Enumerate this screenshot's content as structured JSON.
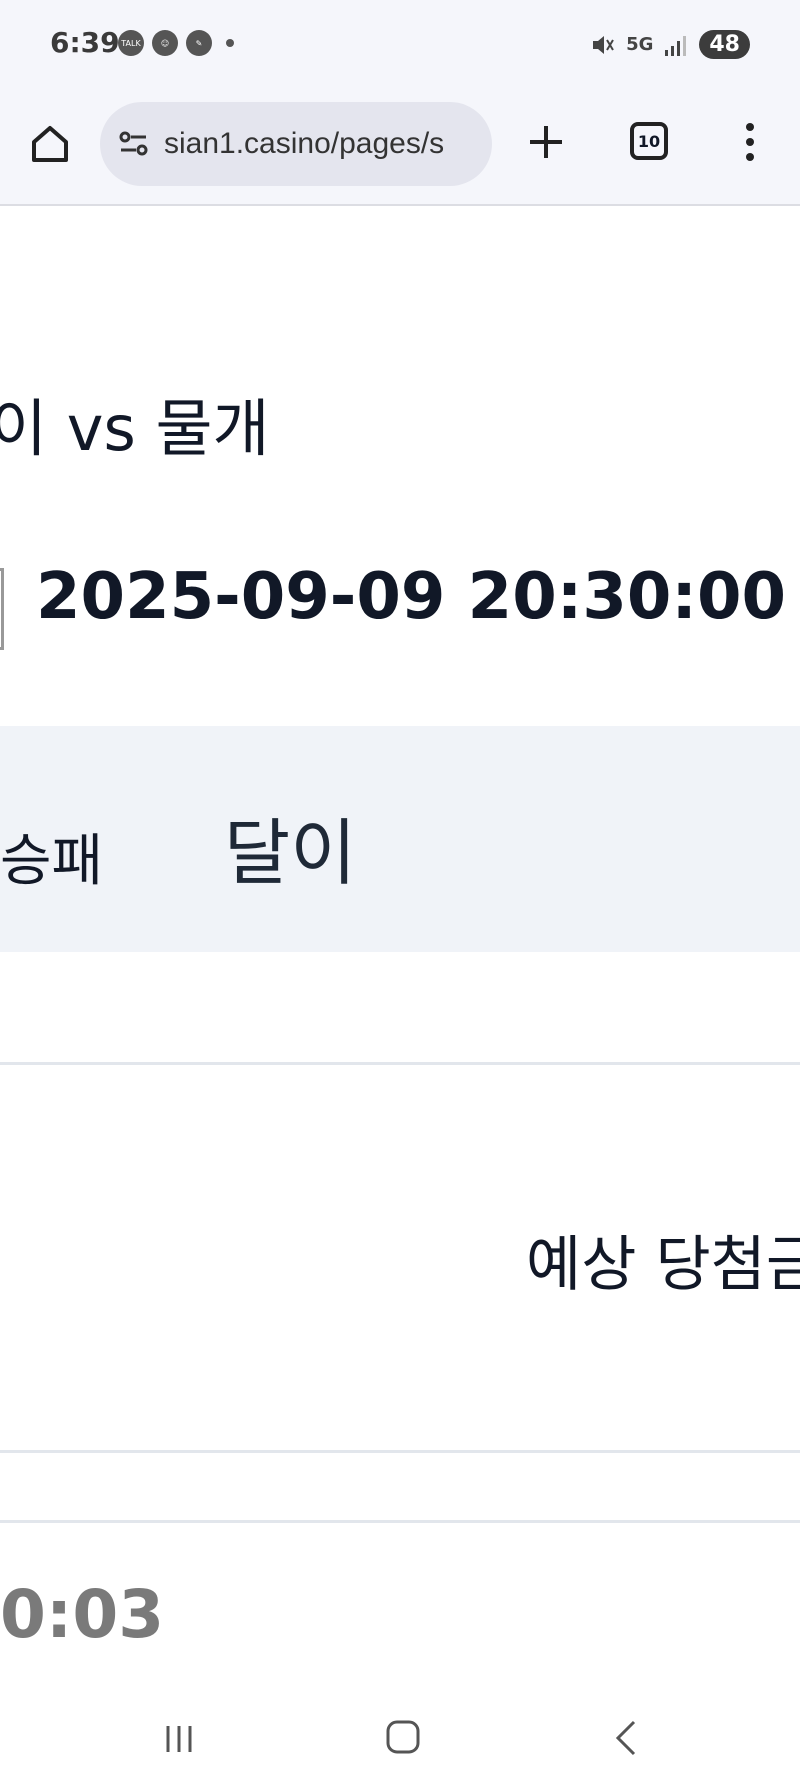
{
  "status_bar": {
    "time": "6:39",
    "left_icons": [
      "talk-icon",
      "face-icon",
      "feather-icon"
    ],
    "right_icons": [
      "mute-icon",
      "5g-icon",
      "signal-icon"
    ],
    "network": "5G",
    "battery": "48"
  },
  "browser": {
    "url": "sian1.casino/pages/s",
    "tab_count": "10"
  },
  "match": {
    "teams": "이 vs 물개",
    "datetime": "2025-09-09 20:30:00"
  },
  "bet": {
    "type_label": "승패",
    "pick": "달이"
  },
  "payout": {
    "label": "예상 당첨금"
  },
  "countdown": {
    "value": "0:03"
  },
  "nav": {
    "buttons": [
      "recent-apps",
      "home",
      "back"
    ]
  },
  "colors": {
    "bar_bg": "#f5f6fb",
    "band_bg": "#f0f3f8",
    "text": "#111827",
    "timer": "#7a7a7a"
  }
}
